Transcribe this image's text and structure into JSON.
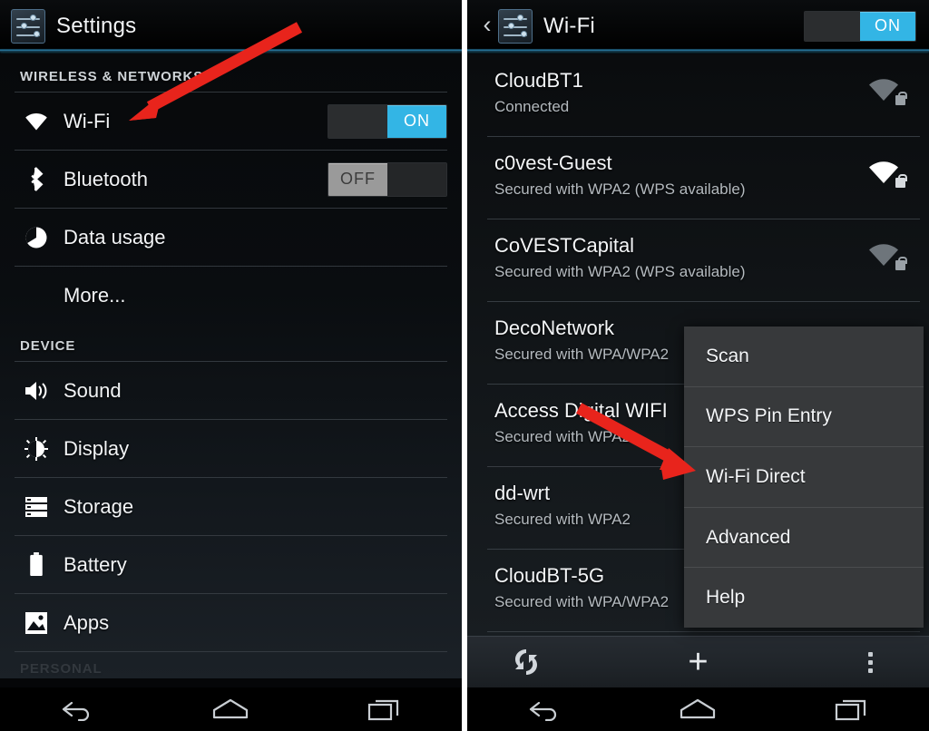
{
  "left_panel": {
    "actionbar": {
      "title": "Settings",
      "icon": "settings-sliders-icon"
    },
    "sections": [
      {
        "header": "WIRELESS & NETWORKS",
        "items": [
          {
            "label": "Wi-Fi",
            "icon": "wifi-icon",
            "toggle": "ON",
            "toggle_state": "on"
          },
          {
            "label": "Bluetooth",
            "icon": "bluetooth-icon",
            "toggle": "OFF",
            "toggle_state": "off"
          },
          {
            "label": "Data usage",
            "icon": "data-usage-icon",
            "toggle": null,
            "toggle_state": null
          },
          {
            "label": "More...",
            "icon": null,
            "toggle": null,
            "toggle_state": null
          }
        ]
      },
      {
        "header": "DEVICE",
        "items": [
          {
            "label": "Sound",
            "icon": "sound-icon",
            "toggle": null,
            "toggle_state": null
          },
          {
            "label": "Display",
            "icon": "display-icon",
            "toggle": null,
            "toggle_state": null
          },
          {
            "label": "Storage",
            "icon": "storage-icon",
            "toggle": null,
            "toggle_state": null
          },
          {
            "label": "Battery",
            "icon": "battery-icon",
            "toggle": null,
            "toggle_state": null
          },
          {
            "label": "Apps",
            "icon": "apps-icon",
            "toggle": null,
            "toggle_state": null
          }
        ]
      },
      {
        "header": "PERSONAL",
        "items": []
      }
    ]
  },
  "right_panel": {
    "actionbar": {
      "title": "Wi-Fi",
      "icon": "settings-sliders-icon",
      "back": "‹",
      "toggle": "ON",
      "toggle_state": "on"
    },
    "networks": [
      {
        "ssid": "CloudBT1",
        "status": "Connected",
        "signal": "dim",
        "secured": true
      },
      {
        "ssid": "c0vest-Guest",
        "status": "Secured with WPA2 (WPS available)",
        "signal": "bright",
        "secured": true
      },
      {
        "ssid": "CoVESTCapital",
        "status": "Secured with WPA2 (WPS available)",
        "signal": "dim",
        "secured": true
      },
      {
        "ssid": "DecoNetwork",
        "status": "Secured with WPA/WPA2",
        "signal": "dim",
        "secured": true
      },
      {
        "ssid": "Access Digital WIFI",
        "status": "Secured with WPA2",
        "signal": "dim",
        "secured": true
      },
      {
        "ssid": "dd-wrt",
        "status": "Secured with WPA2",
        "signal": "dim",
        "secured": true
      },
      {
        "ssid": "CloudBT-5G",
        "status": "Secured with WPA/WPA2",
        "signal": "dim",
        "secured": true
      }
    ],
    "bottom_bar": {
      "wps_icon": "wps-refresh-icon",
      "add_icon": "plus-icon",
      "overflow_icon": "overflow-menu-icon"
    },
    "overflow_menu": {
      "items": [
        "Scan",
        "WPS Pin Entry",
        "Wi-Fi Direct",
        "Advanced",
        "Help"
      ]
    }
  },
  "navbar": {
    "back": "back-icon",
    "home": "home-icon",
    "recents": "recents-icon"
  },
  "annotations": {
    "arrow_color": "#e8241c",
    "arrow_1_target": "Wi-Fi",
    "arrow_2_target": "Wi-Fi Direct"
  },
  "colors": {
    "accent_blue": "#33b5e5",
    "toggle_off_gray": "#9a9a9a",
    "text_primary": "#f2f4f6",
    "text_secondary": "#b4babf",
    "popup_bg": "#37393b",
    "arrow_red": "#e8241c"
  }
}
